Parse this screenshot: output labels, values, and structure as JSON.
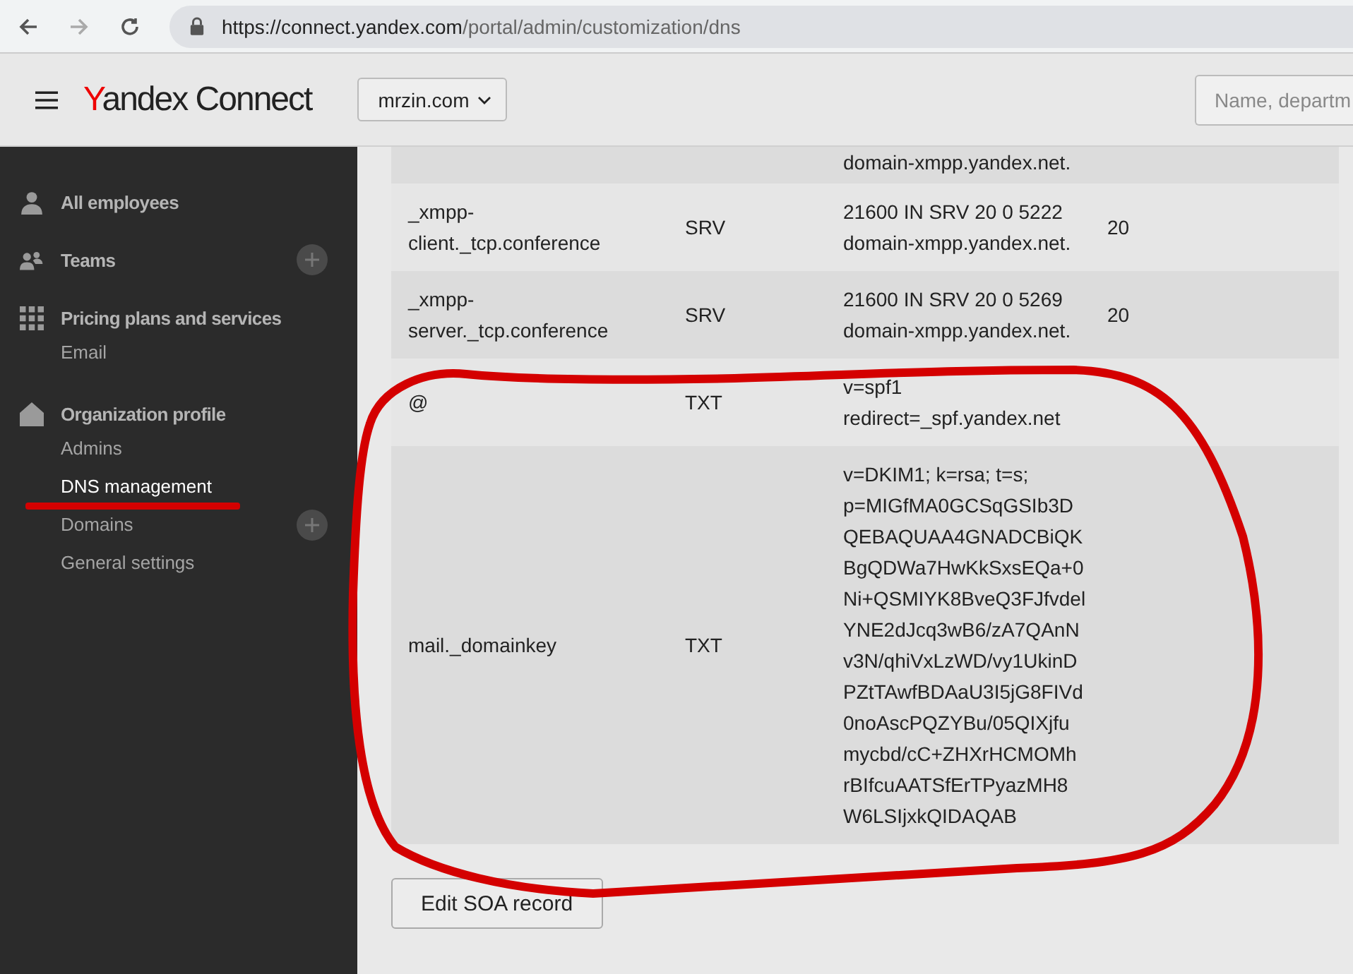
{
  "browser": {
    "url_host": "https://connect.yandex.com",
    "url_path": "/portal/admin/customization/dns",
    "forward_disabled": true
  },
  "header": {
    "logo_mark": "Y",
    "logo_text": "andex Connect",
    "domain": "mrzin.com",
    "search": {
      "placeholder": "Name, departm"
    }
  },
  "sidebar": {
    "sections": [
      {
        "kind": "person",
        "label": "All employees",
        "add": false
      },
      {
        "kind": "people",
        "label": "Teams",
        "add": true
      },
      {
        "kind": "grid",
        "label": "Pricing plans and services",
        "add": false,
        "children": [
          {
            "label": "Email",
            "selected": false,
            "add": false,
            "underlined": false
          }
        ]
      },
      {
        "kind": "house",
        "label": "Organization profile",
        "add": false,
        "children": [
          {
            "label": "Admins",
            "selected": false,
            "add": false,
            "underlined": false
          },
          {
            "label": "DNS management",
            "selected": true,
            "add": false,
            "underlined": true
          },
          {
            "label": "Domains",
            "selected": false,
            "add": true,
            "underlined": false
          },
          {
            "label": "General settings",
            "selected": false,
            "add": false,
            "underlined": false
          }
        ]
      }
    ]
  },
  "table": {
    "rows": [
      {
        "value": [
          "domain-xmpp.yandex.net."
        ]
      },
      {
        "name": [
          "_xmpp-",
          "client._tcp.conference"
        ],
        "type": "SRV",
        "value": [
          "21600 IN SRV 20 0 5222",
          "domain-xmpp.yandex.net."
        ],
        "priority": "20"
      },
      {
        "name": [
          "_xmpp-",
          "server._tcp.conference"
        ],
        "type": "SRV",
        "value": [
          "21600 IN SRV 20 0 5269",
          "domain-xmpp.yandex.net."
        ],
        "priority": "20"
      },
      {
        "name": [
          "@"
        ],
        "type": "TXT",
        "value": [
          "v=spf1",
          "redirect=_spf.yandex.net"
        ]
      },
      {
        "name": [
          "mail._domainkey"
        ],
        "type": "TXT",
        "value": [
          "v=DKIM1; k=rsa; t=s;",
          "p=MIGfMA0GCSqGSIb3D",
          "QEBAQUAA4GNADCBiQK",
          "BgQDWa7HwKkSxsEQa+0",
          "Ni+QSMIYK8BveQ3FJfvdel",
          "YNE2dJcq3wB6/zA7QAnN",
          "v3N/qhiVxLzWD/vy1UkinD",
          "PZtTAwfBDAaU3I5jG8FIVd",
          "0noAscPQZYBu/05QIXjfu",
          "mycbd/cC+ZHXrHCMOMh",
          "rBIfcuAATSfErTPyazMH8",
          "W6LSIjxkQIDAQAB"
        ]
      }
    ]
  },
  "button": "Edit SOA record",
  "annotation": {
    "kind": "ellipse"
  }
}
